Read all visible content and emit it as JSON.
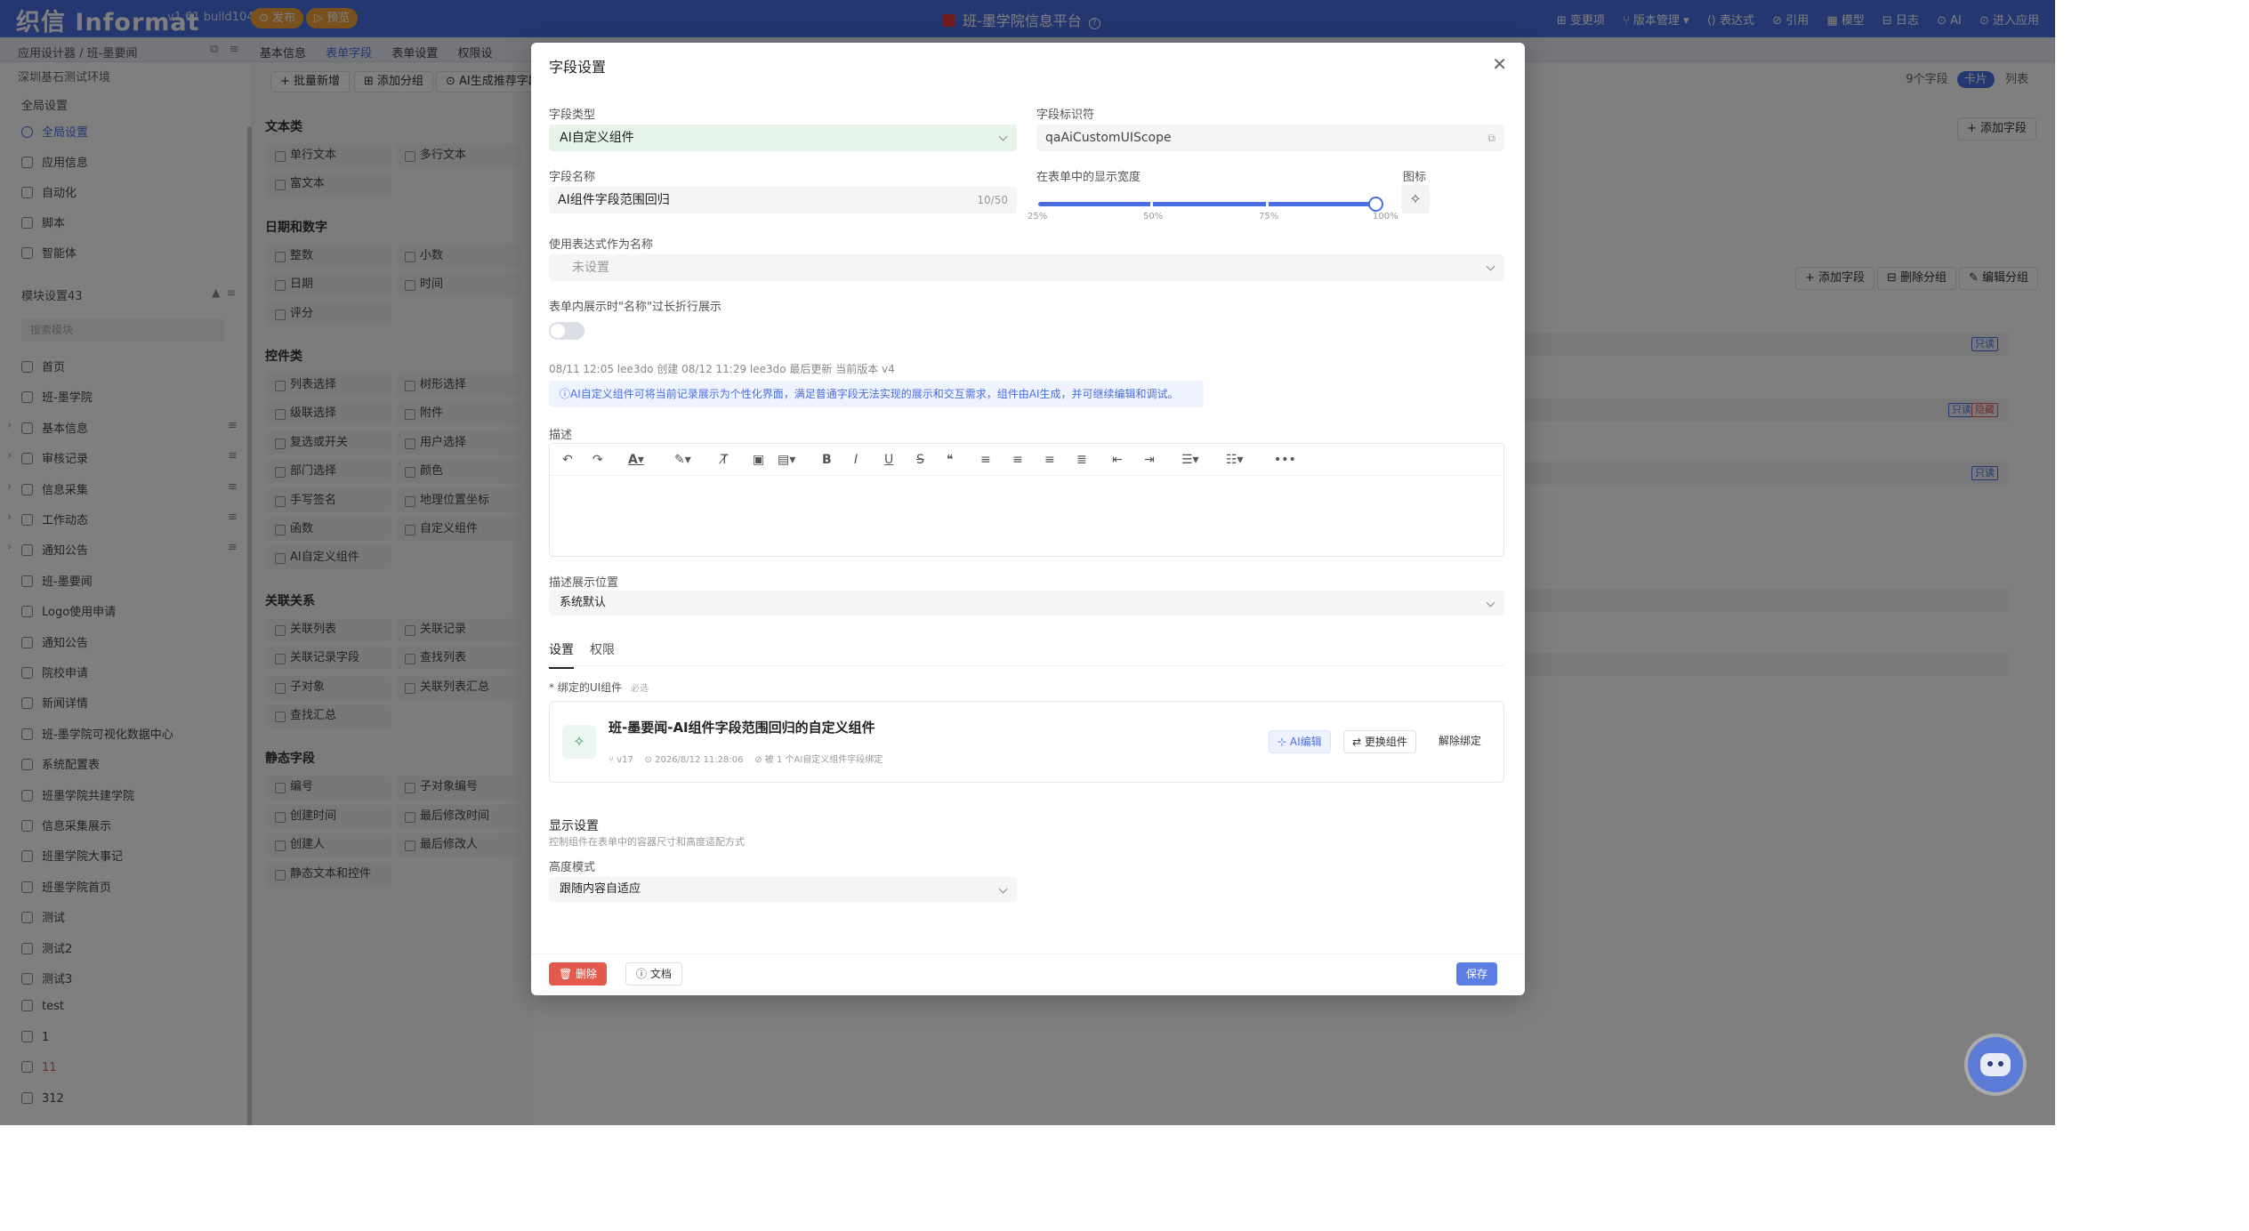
{
  "topbar": {
    "logo": "织信 Informat",
    "version": "v1.61 build1045",
    "publish": "⊙ 发布",
    "preview": "▷ 预览",
    "center_title": "班-墨学院信息平台",
    "nav": [
      "⊞ 变更项",
      "⑂ 版本管理 ▾",
      "⟨⟩ 表达式",
      "⊘ 引用",
      "▦ 模型",
      "⊟ 日志",
      "⊙ AI",
      "⊙ 进入应用"
    ]
  },
  "subbar": {
    "breadcrumb": "应用设计器 / 班-墨要闻",
    "tabs": [
      "基本信息",
      "表单字段",
      "表单设置",
      "权限设"
    ]
  },
  "sidebar": {
    "env": "深圳基石测试环境",
    "global_label": "全局设置",
    "global_items": [
      "全局设置",
      "应用信息",
      "自动化",
      "脚本",
      "智能体"
    ],
    "module_label": "模块设置43",
    "search_placeholder": "搜索模块",
    "modules": [
      "首页",
      "班-墨学院",
      "基本信息",
      "审核记录",
      "信息采集",
      "工作动态",
      "通知公告",
      "班-墨要闻",
      "Logo使用申请",
      "通知公告",
      "院校申请",
      "新闻详情",
      "班-墨学院可视化数据中心",
      "系统配置表",
      "班墨学院共建学院",
      "信息采集展示",
      "班墨学院大事记",
      "班墨学院首页",
      "测试",
      "测试2",
      "测试3",
      "test",
      "1",
      "11",
      "312"
    ]
  },
  "palette": {
    "batch_add": "+ 批量新增",
    "add_group": "⊞ 添加分组",
    "ai_recommend": "⊙ AI生成推荐字段",
    "groups": [
      {
        "title": "文本类",
        "items": [
          "单行文本",
          "多行文本",
          "富文本"
        ]
      },
      {
        "title": "日期和数字",
        "items": [
          "整数",
          "小数",
          "日期",
          "时间",
          "评分"
        ]
      },
      {
        "title": "控件类",
        "items": [
          "列表选择",
          "树形选择",
          "级联选择",
          "附件",
          "复选或开关",
          "用户选择",
          "部门选择",
          "颜色",
          "手写签名",
          "地理位置坐标",
          "函数",
          "自定义组件",
          "AI自定义组件"
        ]
      },
      {
        "title": "关联关系",
        "items": [
          "关联列表",
          "关联记录",
          "关联记录字段",
          "查找列表",
          "子对象",
          "关联列表汇总",
          "查找汇总"
        ]
      },
      {
        "title": "静态字段",
        "items": [
          "编号",
          "子对象编号",
          "创建时间",
          "最后修改时间",
          "创建人",
          "最后修改人",
          "静态文本和控件"
        ]
      }
    ]
  },
  "main": {
    "field_count": "9个字段",
    "view_card": "卡片",
    "view_list": "列表",
    "add_field_1": "+ 添加字段",
    "add_field_2": "+ 添加字段",
    "delete_group": "⊟ 删除分组",
    "edit_group": "✎ 编辑分组",
    "readonly": "只读",
    "hidden": "隐藏"
  },
  "modal": {
    "title": "字段设置",
    "field_type_label": "字段类型",
    "field_type_value": "AI自定义组件",
    "field_id_label": "字段标识符",
    "field_id_value": "qaAiCustomUIScope",
    "field_name_label": "字段名称",
    "field_name_value": "AI组件字段范围回归",
    "field_name_counter": "10/50",
    "width_label": "在表单中的显示宽度",
    "width_marks": [
      "25%",
      "50%",
      "75%",
      "100%"
    ],
    "width_value": 1.0,
    "icon_label": "图标",
    "expr_label": "使用表达式作为名称",
    "expr_value": "未设置",
    "wrap_label": "表单内展示时\"名称\"过长折行展示",
    "wrap_on": false,
    "meta": "08/11 12:05 lee3do 创建 08/12 11:29 lee3do 最后更新 当前版本 v4",
    "notice": "ⓘAI自定义组件可将当前记录展示为个性化界面，满足普通字段无法实现的展示和交互需求，组件由AI生成，并可继续编辑和调试。",
    "desc_label": "描述",
    "desc_pos_label": "描述展示位置",
    "desc_pos_value": "系统默认",
    "tabs": [
      "设置",
      "权限"
    ],
    "bind_label": "* 绑定的UI组件",
    "bind_required": "必选",
    "card_title": "班-墨要闻-AI组件字段范围回归的自定义组件",
    "card_version": "⑂ v17",
    "card_time": "⊙ 2026/8/12 11:28:06",
    "card_binding": "⊘ 被 1 个AI自定义组件字段绑定",
    "ai_edit": "⊹ AI编辑",
    "replace": "⇄ 更换组件",
    "unbind": "解除绑定",
    "display_title": "显示设置",
    "display_sub": "控制组件在表单中的容器尺寸和高度适配方式",
    "height_label": "高度模式",
    "height_value": "跟随内容自适应",
    "delete": "🗑 删除",
    "doc": "ⓘ 文档",
    "save": "保存"
  }
}
